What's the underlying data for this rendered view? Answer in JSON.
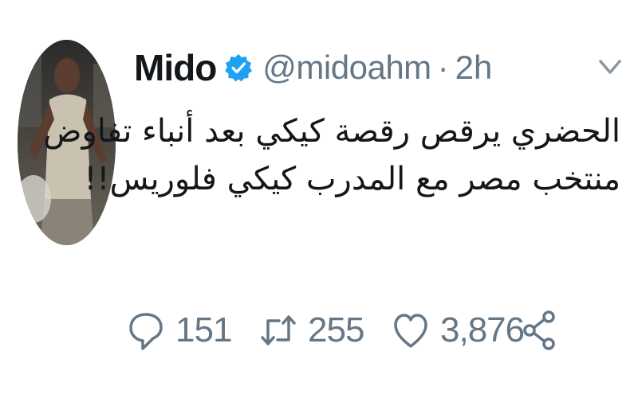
{
  "author": {
    "display_name": "Mido",
    "handle": "@midoahm",
    "separator": "·",
    "time": "2h",
    "verified": true
  },
  "tweet": {
    "lines": [
      "الحضري يرقص رقصة كيكي بعد أنباء تفاوض",
      "منتخب مصر مع المدرب كيكي فلوريس!!"
    ]
  },
  "actions": {
    "replies": "151",
    "retweets": "255",
    "likes": "3,876"
  },
  "colors": {
    "text": "#14171a",
    "secondary": "#657786",
    "verified_badge": "#1da1f2"
  },
  "icons": [
    "verified-badge-icon",
    "chevron-down-icon",
    "reply-icon",
    "retweet-icon",
    "like-icon",
    "share-icon"
  ]
}
